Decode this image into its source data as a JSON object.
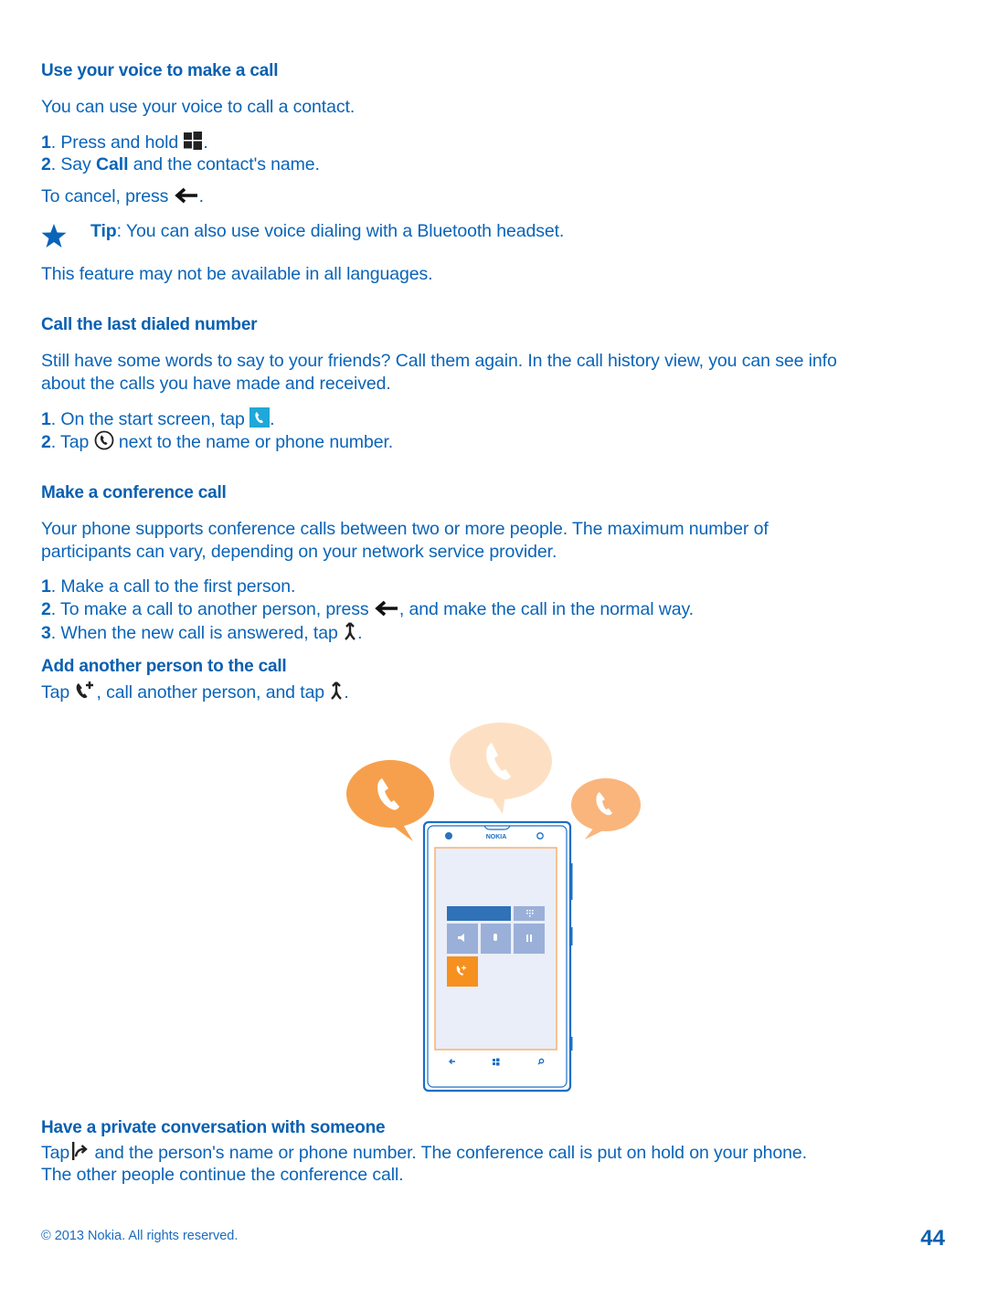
{
  "sections": {
    "voice": {
      "heading": "Use your voice to make a call",
      "intro": "You can use your voice to call a contact.",
      "steps": [
        {
          "num": "1",
          "text_before": "Press and hold",
          "icon": "windows-start-icon",
          "text_after": "."
        },
        {
          "num": "2",
          "text_before": "Say",
          "bold": "Call",
          "text_after": "and the contact's name."
        }
      ],
      "cancel_before": "To cancel, press",
      "cancel_icon": "back-arrow-icon",
      "cancel_after": ".",
      "tip_label": "Tip",
      "tip_text": ": You can also use voice dialing with a Bluetooth headset.",
      "note": "This feature may not be available in all languages."
    },
    "last_dialed": {
      "heading": "Call the last dialed number",
      "intro_line1": "Still have some words to say to your friends? Call them again. In the call history view, you can see info",
      "intro_line2": "about the calls you have made and received.",
      "steps": [
        {
          "num": "1",
          "text_before": "On the start screen, tap",
          "icon": "phone-tile-icon",
          "text_after": "."
        },
        {
          "num": "2",
          "text_before": "Tap",
          "icon": "call-circle-icon",
          "text_after": "next to the name or phone number."
        }
      ]
    },
    "conference": {
      "heading": "Make a conference call",
      "intro_line1": "Your phone supports conference calls between two or more people. The maximum number of",
      "intro_line2": "participants can vary, depending on your network service provider.",
      "steps": [
        {
          "num": "1",
          "text": "Make a call to the first person."
        },
        {
          "num": "2",
          "text_before": "To make a call to another person, press",
          "icon": "back-arrow-icon",
          "text_after": ", and make the call in the normal way."
        },
        {
          "num": "3",
          "text_before": "When the new call is answered, tap",
          "icon": "merge-calls-icon",
          "text_after": "."
        }
      ]
    },
    "add_person": {
      "heading": "Add another person to the call",
      "text_before": "Tap",
      "icon1": "add-call-icon",
      "text_middle": ", call another person, and tap",
      "icon2": "merge-calls-icon",
      "text_after": "."
    },
    "private": {
      "heading": "Have a private conversation with someone",
      "text_before": "Tap",
      "icon": "private-call-icon",
      "line1_after": "and the person's name or phone number. The conference call is put on hold on your phone.",
      "line2": "The other people continue the conference call."
    }
  },
  "illustration": {
    "phone_brand": "NOKIA",
    "colors": {
      "bubble_left": "#f6a04d",
      "bubble_center": "#fde0c4",
      "bubble_right": "#f9b57c",
      "phone_outline": "#1a6fc4",
      "screen_border": "#f8b070",
      "screen_bg": "#eaeef8",
      "tile_blue": "#2f72b8",
      "tile_light": "#9ab0d8",
      "tile_orange": "#f6901e"
    }
  },
  "footer": {
    "copyright": "© 2013 Nokia. All rights reserved.",
    "page_number": "44"
  },
  "colors": {
    "text": "#0a64b8",
    "heading": "#0a60b0"
  }
}
